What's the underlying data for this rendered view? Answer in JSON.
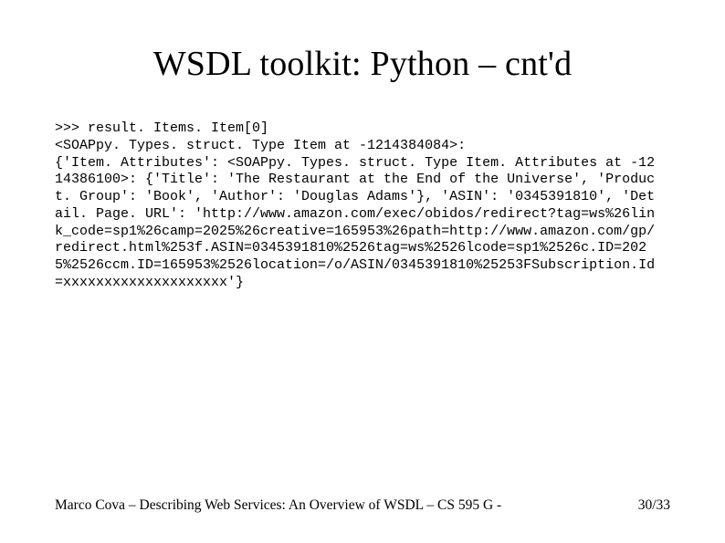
{
  "title": "WSDL toolkit: Python – cnt'd",
  "code": ">>> result. Items. Item[0]\n<SOAPpy. Types. struct. Type Item at -1214384084>:\n{'Item. Attributes': <SOAPpy. Types. struct. Type Item. Attributes at -1214386100>: {'Title': 'The Restaurant at the End of the Universe', 'Product. Group': 'Book', 'Author': 'Douglas Adams'}, 'ASIN': '0345391810', 'Detail. Page. URL': 'http://www.amazon.com/exec/obidos/redirect?tag=ws%26link_code=sp1%26camp=2025%26creative=165953%26path=http://www.amazon.com/gp/redirect.html%253f.ASIN=0345391810%2526tag=ws%2526lcode=sp1%2526c.ID=2025%2526ccm.ID=165953%2526location=/o/ASIN/0345391810%25253FSubscription.Id=xxxxxxxxxxxxxxxxxxxx'}",
  "footer": {
    "left": "Marco Cova – Describing Web Services: An Overview of WSDL – CS 595 G -",
    "right": "30/33"
  }
}
